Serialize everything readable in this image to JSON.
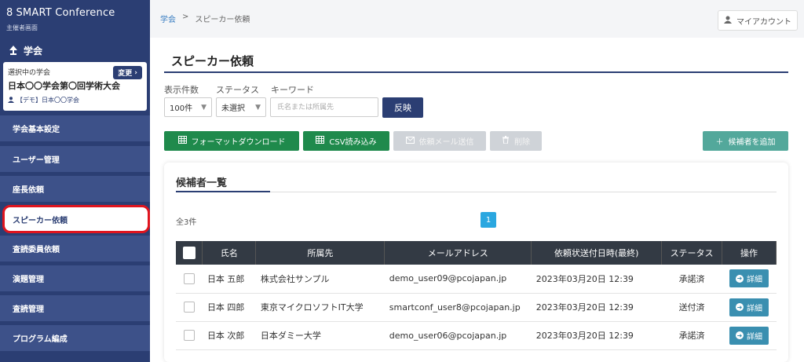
{
  "app": {
    "brand": "SMART Conference",
    "subtitle": "主催者画面"
  },
  "sidebar": {
    "section": "学会",
    "current": {
      "label": "選択中の学会",
      "change": "変更",
      "name": "日本〇〇学会第〇回学術大会",
      "demo": "【デモ】日本〇〇学会"
    },
    "items": [
      {
        "label": "学会基本設定"
      },
      {
        "label": "ユーザー管理"
      },
      {
        "label": "座長依頼"
      },
      {
        "label": "スピーカー依頼"
      },
      {
        "label": "査読委員依頼"
      },
      {
        "label": "演題管理"
      },
      {
        "label": "査読管理"
      },
      {
        "label": "プログラム編成"
      }
    ]
  },
  "header": {
    "breadcrumb": {
      "root": "学会",
      "sep": ">",
      "current": "スピーカー依頼"
    },
    "account": "マイアカウント"
  },
  "page": {
    "title": "スピーカー依頼"
  },
  "filters": {
    "count_label": "表示件数",
    "status_label": "ステータス",
    "keyword_label": "キーワード",
    "count_value": "100件",
    "status_value": "未選択",
    "keyword_placeholder": "氏名または所属先",
    "apply": "反映"
  },
  "actions": {
    "download": "フォーマットダウンロード",
    "csv": "CSV読み込み",
    "mail": "依頼メール送信",
    "delete": "削除",
    "add": "候補者を追加"
  },
  "list": {
    "title": "候補者一覧",
    "count": "全3件",
    "page": "1",
    "columns": [
      "氏名",
      "所属先",
      "メールアドレス",
      "依頼状送付日時(最終)",
      "ステータス",
      "操作"
    ],
    "rows": [
      {
        "name": "日本 五郎",
        "affiliation": "株式会社サンプル",
        "email": "demo_user09@pcojapan.jp",
        "sent": "2023年03月20日 12:39",
        "status": "承諾済",
        "action": "詳細"
      },
      {
        "name": "日本 四郎",
        "affiliation": "東京マイクロソフトIT大学",
        "email": "smartconf_user8@pcojapan.jp",
        "sent": "2023年03月20日 12:39",
        "status": "送付済",
        "action": "詳細"
      },
      {
        "name": "日本 次郎",
        "affiliation": "日本ダミー大学",
        "email": "demo_user06@pcojapan.jp",
        "sent": "2023年03月20日 12:39",
        "status": "承諾済",
        "action": "詳細"
      }
    ]
  }
}
